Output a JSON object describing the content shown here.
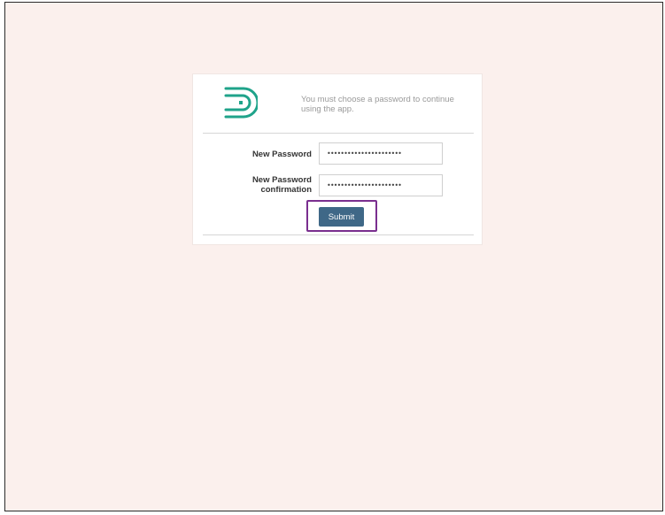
{
  "brand": {
    "logo_icon": "brand-logo-icon",
    "accent_color": "#1fa38a"
  },
  "card": {
    "message": "You must choose a password to continue using the app."
  },
  "form": {
    "new_password_label": "New Password",
    "new_password_value": "••••••••••••••••••••••",
    "confirmation_label": "New Password confirmation",
    "confirmation_value": "••••••••••••••••••••••",
    "submit_label": "Submit",
    "submit_color": "#3f6887",
    "highlight_color": "#7a2f8f"
  }
}
